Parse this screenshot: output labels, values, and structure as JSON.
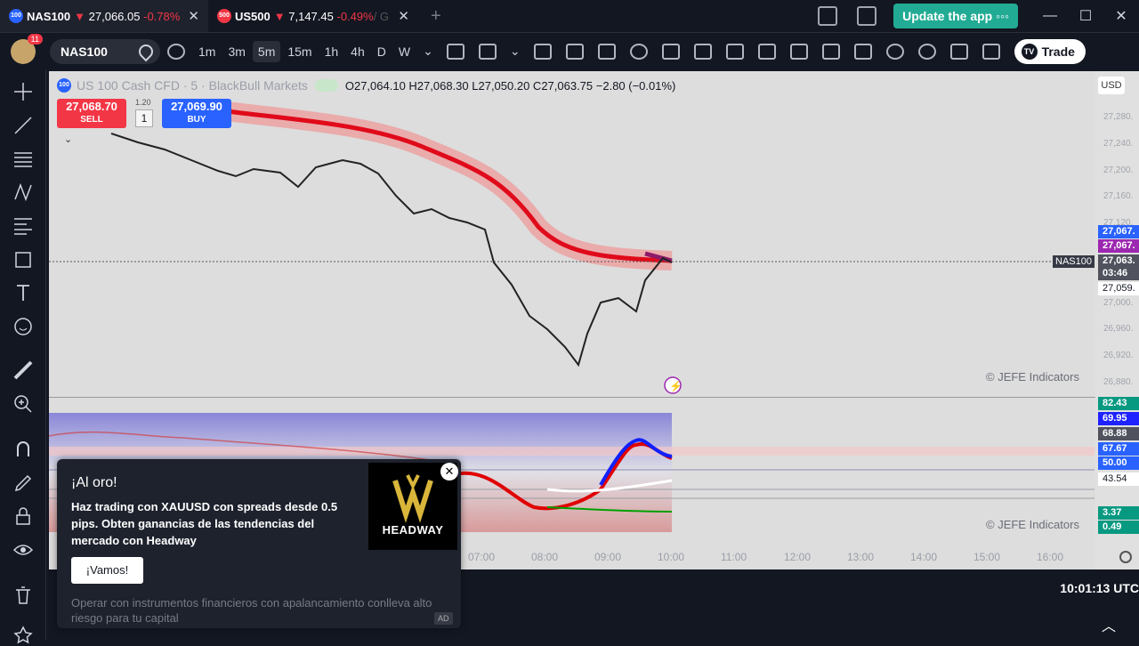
{
  "tabs": [
    {
      "badge": "100",
      "symbol": "NAS100",
      "arrow": "▼",
      "price": "27,066.05",
      "change": "-0.78%",
      "close": "✕"
    },
    {
      "badge": "500",
      "symbol": "US500",
      "arrow": "▼",
      "price": "7,147.45",
      "change": "-0.49%",
      "suffix": "/ G",
      "close": "✕"
    }
  ],
  "new_tab": "+",
  "update_button": "Update the app",
  "update_dots": "◦◦◦",
  "window_controls": {
    "minimize": "—",
    "maximize": "☐",
    "close": "✕"
  },
  "avatar_badge": "11",
  "symbol": "NAS100",
  "intervals": [
    "1m",
    "3m",
    "5m",
    "15m",
    "1h",
    "4h",
    "D",
    "W"
  ],
  "selected_interval": "5m",
  "trade_button": "Trade",
  "trade_logo": "TV",
  "chart": {
    "badge": "100",
    "name": "US 100 Cash CFD · 5 · BlackBull Markets",
    "ohlc": "O27,064.10 H27,068.30 L27,050.20 C27,063.75 −2.80 (−0.01%)",
    "sell_price": "27,068.70",
    "sell_label": "SELL",
    "buy_price": "27,069.90",
    "buy_label": "BUY",
    "spread": "1.20",
    "quantity": "1",
    "collapse": "⌄",
    "currency": "USD",
    "symbol_tag": "NAS100",
    "price_ticks": [
      "27,280.",
      "27,240.",
      "27,200.",
      "27,160.",
      "27,120.",
      "27,080.",
      "27,040.",
      "27,000.",
      "26,960.",
      "26,920.",
      "26,880."
    ],
    "price_labels": [
      {
        "text": "27,067.",
        "color": "#2962ff"
      },
      {
        "text": "27,067.",
        "color": "#9c27b0"
      },
      {
        "text": "27,063.",
        "color": "#50535e"
      },
      {
        "text": "03:46",
        "color": "#50535e"
      },
      {
        "text": "27,059.",
        "color": "#ffffff"
      }
    ],
    "watermark": "© JEFE Indicators"
  },
  "oscillator": {
    "labels": [
      {
        "text": "82.43",
        "color": "#089981"
      },
      {
        "text": "69.95",
        "color": "#1e22ff"
      },
      {
        "text": "68.88",
        "color": "#50535e"
      },
      {
        "text": "67.67",
        "color": "#2962ff"
      },
      {
        "text": "50.00",
        "color": "#2962ff"
      },
      {
        "text": "43.54",
        "color": "#ffffff"
      },
      {
        "text": "3.37",
        "color": "#089981"
      },
      {
        "text": "0.49",
        "color": "#089981"
      }
    ],
    "watermark": "© JEFE Indicators"
  },
  "time_ticks": [
    "07:00",
    "08:00",
    "09:00",
    "10:00",
    "11:00",
    "12:00",
    "13:00",
    "14:00",
    "15:00",
    "16:00"
  ],
  "clock": "10:01:13 UTC",
  "ad": {
    "title": "¡Al oro!",
    "body": "Haz trading con XAUUSD con spreads desde 0.5 pips. Obten ganancias de las tendencias del mercado con Headway",
    "button": "¡Vamos!",
    "logo_text": "HEADWAY",
    "disclaimer": "Operar con instrumentos financieros con apalancamiento conlleva alto riesgo para tu capital",
    "tag": "AD",
    "close": "✕"
  }
}
